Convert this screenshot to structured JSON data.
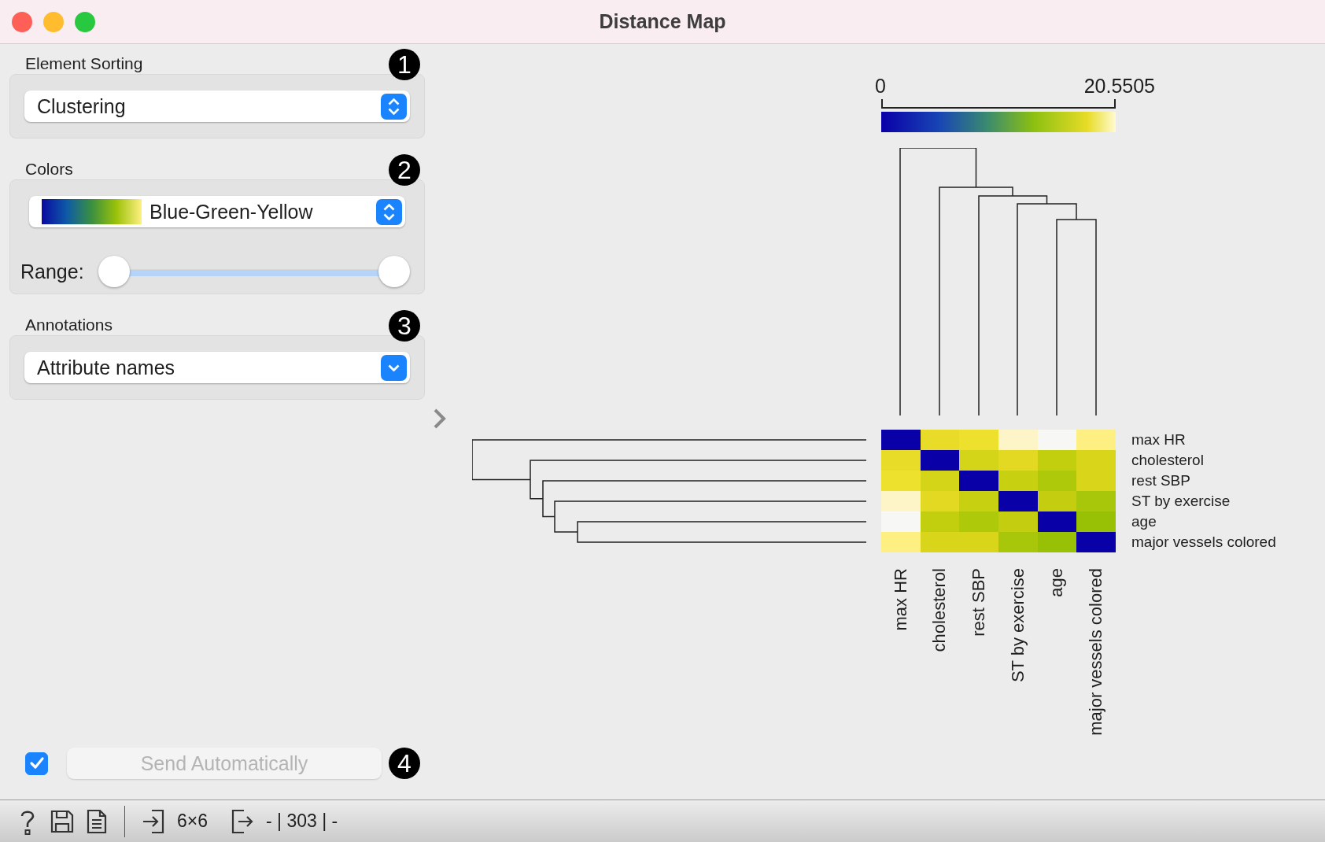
{
  "window": {
    "title": "Distance Map"
  },
  "sidebar": {
    "sections": [
      {
        "kind": "combo",
        "label": "Element Sorting",
        "badge": "1",
        "value": "Clustering"
      },
      {
        "kind": "palette",
        "label": "Colors",
        "badge": "2",
        "value": "Blue-Green-Yellow",
        "range": {
          "label": "Range:",
          "thumbs": [
            {
              "level": 0
            },
            {
              "level": 1
            }
          ]
        }
      },
      {
        "kind": "dropdown",
        "label": "Annotations",
        "badge": "3",
        "value": "Attribute names"
      }
    ],
    "auto_send": {
      "checked": true,
      "label": "Send Automatically",
      "disabled": true,
      "badge": "4"
    }
  },
  "plot": {
    "legend": {
      "min": "0",
      "max": "20.5505"
    },
    "row_labels": [
      "max HR",
      "cholesterol",
      "rest SBP",
      "ST by exercise",
      "age",
      "major vessels colored"
    ],
    "column_labels": [
      "max HR",
      "cholesterol",
      "rest SBP",
      "ST by exercise",
      "age",
      "major vessels colored"
    ],
    "cells": [
      [
        {
          "color": "#0a00a8"
        },
        {
          "color": "#e8dc28"
        },
        {
          "color": "#ede12e"
        },
        {
          "color": "#fdf5c8"
        },
        {
          "color": "#f7f7f5"
        },
        {
          "color": "#fdef82"
        }
      ],
      [
        {
          "color": "#e8dc28"
        },
        {
          "color": "#0a00a8"
        },
        {
          "color": "#d4d418"
        },
        {
          "color": "#e3d923"
        },
        {
          "color": "#c2cf0f"
        },
        {
          "color": "#d8d51a"
        }
      ],
      [
        {
          "color": "#ede12e"
        },
        {
          "color": "#d4d418"
        },
        {
          "color": "#0a00a8"
        },
        {
          "color": "#c8d012"
        },
        {
          "color": "#aec90a"
        },
        {
          "color": "#d8d51a"
        }
      ],
      [
        {
          "color": "#fdf5c8"
        },
        {
          "color": "#e3d923"
        },
        {
          "color": "#c8d012"
        },
        {
          "color": "#0a00a8"
        },
        {
          "color": "#c4cd10"
        },
        {
          "color": "#a8c60a"
        }
      ],
      [
        {
          "color": "#f7f7f5"
        },
        {
          "color": "#c2cf0f"
        },
        {
          "color": "#aec90a"
        },
        {
          "color": "#c4cd10"
        },
        {
          "color": "#0a00a8"
        },
        {
          "color": "#98c106"
        }
      ],
      [
        {
          "color": "#fdef82"
        },
        {
          "color": "#d8d51a"
        },
        {
          "color": "#d8d51a"
        },
        {
          "color": "#a8c60a"
        },
        {
          "color": "#98c106"
        },
        {
          "color": "#0a00a8"
        }
      ]
    ]
  },
  "status_bar": {
    "input": "6×6",
    "output": "- | 303 | -"
  }
}
